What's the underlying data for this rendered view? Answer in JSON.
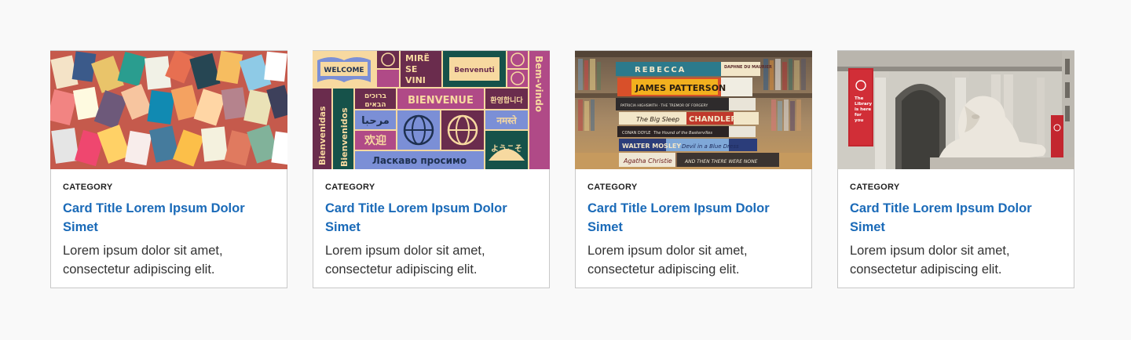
{
  "cards": [
    {
      "category": "CATEGORY",
      "title": "Card Title Lorem Ipsum Dolor Simet",
      "description": "Lorem ipsum dolor sit amet, consectetur adipiscing elit."
    },
    {
      "category": "CATEGORY",
      "title": "Card Title Lorem Ipsum Dolor Simet",
      "description": "Lorem ipsum dolor sit amet, consectetur adipiscing elit."
    },
    {
      "category": "CATEGORY",
      "title": "Card Title Lorem Ipsum Dolor Simet",
      "description": "Lorem ipsum dolor sit amet, consectetur adipiscing elit."
    },
    {
      "category": "CATEGORY",
      "title": "Card Title Lorem Ipsum Dolor Simet",
      "description": "Lorem ipsum dolor sit amet, consectetur adipiscing elit."
    }
  ],
  "images": {
    "welcome": {
      "words": [
        "WELCOME",
        "MIRË",
        "SE",
        "VINI",
        "Benvenuti",
        "Bem-vindo",
        "ברוכים",
        "הבאים",
        "BIENVENUE",
        "환영합니다",
        "Bienvenidas",
        "مرحبا",
        "नमस्ते",
        "Bienvenidos",
        "欢迎",
        "Ласкаво просимо",
        "ようこそ"
      ]
    },
    "books": {
      "spines": [
        "REBECCA",
        "DAPHNE DU MAURIER",
        "JAMES PATTERSON",
        "PATRICIA HIGHSMITH · THE TREMOR OF FORGERY",
        "The Big Sleep",
        "CHANDLER",
        "CONAN DOYLE",
        "The Hound of the Baskervilles",
        "WALTER MOSLEY",
        "Devil in a Blue Dress",
        "Agatha Christie",
        "AND THEN THERE WERE NONE"
      ]
    },
    "library": {
      "banner_left": [
        "The",
        "Library",
        "is here",
        "for",
        "you"
      ]
    }
  },
  "colors": {
    "title": "#1a6ab8",
    "border": "#c9c9c9",
    "background": "#f9f9f9",
    "text": "#333333"
  }
}
